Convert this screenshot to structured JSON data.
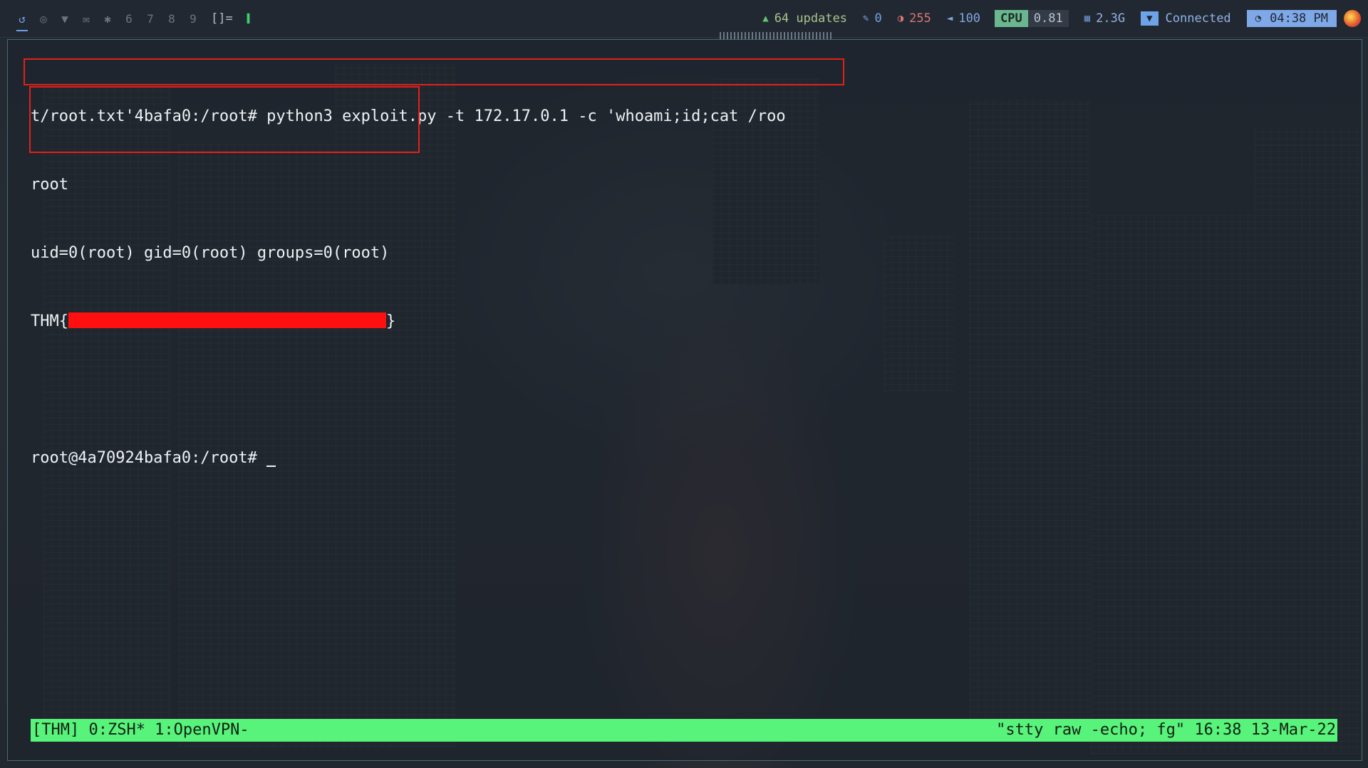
{
  "topbar": {
    "workspaces": [
      {
        "label": "↺",
        "icon": "distro-logo-icon"
      },
      {
        "label": "◎",
        "icon": "browser-icon"
      },
      {
        "label": "▼",
        "icon": "shield-icon"
      },
      {
        "label": "✉",
        "icon": "mail-icon"
      },
      {
        "label": "✱",
        "icon": "settings-icon"
      },
      {
        "label": "6"
      },
      {
        "label": "7"
      },
      {
        "label": "8"
      },
      {
        "label": "9"
      }
    ],
    "layout": "[]=",
    "mini_term": "▌",
    "updates": {
      "icon": "▲",
      "text": "64 updates"
    },
    "brush": {
      "icon": "✎",
      "text": "0"
    },
    "contrast": {
      "icon": "◑",
      "text": "255"
    },
    "volume": {
      "icon": "◄",
      "text": "100"
    },
    "cpu": {
      "label": "CPU",
      "value": "0.81"
    },
    "memory": {
      "icon": "▦",
      "text": "2.3G"
    },
    "vpn": {
      "icon": "▼",
      "text": "Connected"
    },
    "clock": {
      "icon": "◔",
      "text": "04:38 PM"
    }
  },
  "terminal": {
    "command_line": "t/root.txt'4bafa0:/root# python3 exploit.py -t 172.17.0.1 -c 'whoami;id;cat /roo",
    "output": [
      "root",
      "uid=0(root) gid=0(root) groups=0(root)"
    ],
    "flag_prefix": "THM{",
    "flag_suffix": "}",
    "prompt": "root@4a70924bafa0:/root# "
  },
  "tmux": {
    "left": "[THM] 0:ZSH* 1:OpenVPN-",
    "right": "\"stty raw -echo; fg\" 16:38 13-Mar-22"
  },
  "colors": {
    "highlight": "#e1211b",
    "redaction": "#ff0f0f",
    "tmux_bar": "#58f37a",
    "accent": "#6aa3e8"
  }
}
